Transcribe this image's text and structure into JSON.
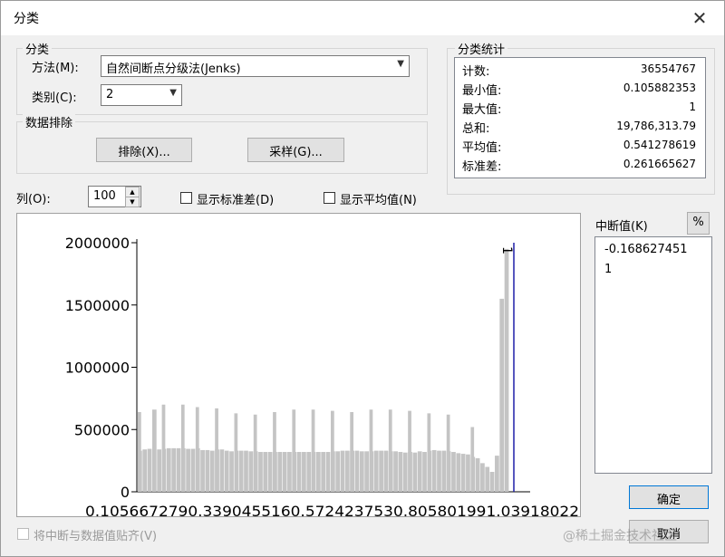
{
  "window": {
    "title": "分类"
  },
  "classification": {
    "group_label": "分类",
    "method_label": "方法(M):",
    "method_value": "自然间断点分级法(Jenks)",
    "classes_label": "类别(C):",
    "classes_value": "2"
  },
  "exclusion": {
    "group_label": "数据排除",
    "exclude_button": "排除(X)...",
    "sample_button": "采样(G)..."
  },
  "statistics": {
    "group_label": "分类统计",
    "rows": [
      {
        "label": "计数:",
        "value": "36554767"
      },
      {
        "label": "最小值:",
        "value": "0.105882353"
      },
      {
        "label": "最大值:",
        "value": "1"
      },
      {
        "label": "总和:",
        "value": "19,786,313.79"
      },
      {
        "label": "平均值:",
        "value": "0.541278619"
      },
      {
        "label": "标准差:",
        "value": "0.261665627"
      }
    ]
  },
  "options": {
    "columns_label": "列(O):",
    "columns_value": "100",
    "show_std_label": "显示标准差(D)",
    "show_mean_label": "显示平均值(N)"
  },
  "breaks": {
    "label": "中断值(K)",
    "percent_button": "%",
    "values": [
      "-0.168627451",
      "1"
    ]
  },
  "footer": {
    "snap_label": "将中断与数据值贴齐(V)",
    "ok_button": "确定",
    "cancel_button": "取消",
    "watermark": "@稀土掘金技术社区"
  },
  "chart_data": {
    "type": "bar",
    "y_ticks": [
      "2000000",
      "1500000",
      "1000000",
      "500000",
      "0"
    ],
    "x_tick_text": "0.1056672790.3390455160.5724237530.805801991.03918022",
    "ylim": [
      0,
      2000000
    ],
    "xlim": [
      0.105667279,
      1.03918022
    ],
    "break_marker": {
      "x": 1,
      "label": "1"
    },
    "bars": [
      330000,
      340000,
      345000,
      660000,
      340000,
      345000,
      350000,
      350000,
      350000,
      350000,
      345000,
      345000,
      350000,
      335000,
      335000,
      330000,
      340000,
      340000,
      330000,
      325000,
      330000,
      330000,
      330000,
      325000,
      325000,
      320000,
      320000,
      320000,
      320000,
      320000,
      320000,
      320000,
      320000,
      320000,
      320000,
      320000,
      320000,
      320000,
      320000,
      320000,
      325000,
      325000,
      330000,
      330000,
      330000,
      330000,
      325000,
      325000,
      325000,
      330000,
      330000,
      330000,
      325000,
      325000,
      320000,
      315000,
      320000,
      315000,
      325000,
      320000,
      330000,
      335000,
      330000,
      330000,
      325000,
      320000,
      310000,
      305000,
      300000,
      280000,
      270000,
      230000,
      200000,
      160000,
      290000,
      1550000,
      1950000
    ],
    "spikes": [
      {
        "bar": 0,
        "value": 640000
      },
      {
        "bar": 5,
        "value": 700000
      },
      {
        "bar": 9,
        "value": 700000
      },
      {
        "bar": 12,
        "value": 680000
      },
      {
        "bar": 16,
        "value": 670000
      },
      {
        "bar": 20,
        "value": 630000
      },
      {
        "bar": 24,
        "value": 620000
      },
      {
        "bar": 28,
        "value": 640000
      },
      {
        "bar": 32,
        "value": 660000
      },
      {
        "bar": 36,
        "value": 660000
      },
      {
        "bar": 40,
        "value": 650000
      },
      {
        "bar": 44,
        "value": 640000
      },
      {
        "bar": 48,
        "value": 660000
      },
      {
        "bar": 52,
        "value": 660000
      },
      {
        "bar": 56,
        "value": 650000
      },
      {
        "bar": 60,
        "value": 630000
      },
      {
        "bar": 64,
        "value": 620000
      },
      {
        "bar": 69,
        "value": 520000
      }
    ]
  }
}
